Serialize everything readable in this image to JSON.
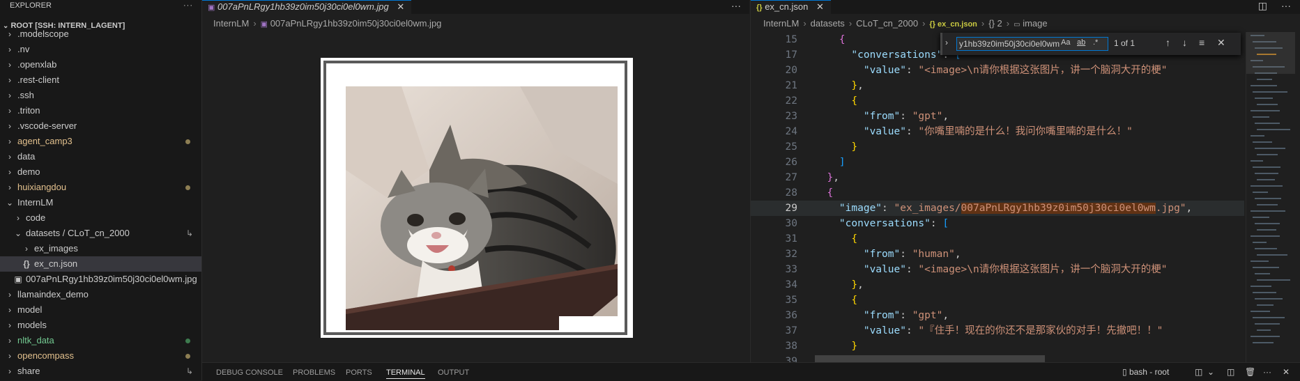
{
  "sidebar": {
    "header": "EXPLORER",
    "root": "ROOT [SSH: INTERN_LAGENT]",
    "items": [
      {
        "label": ".modelscope",
        "kind": "folder",
        "depth": 0,
        "expanded": false,
        "color": "def"
      },
      {
        "label": ".nv",
        "kind": "folder",
        "depth": 0,
        "expanded": false,
        "color": "def"
      },
      {
        "label": ".openxlab",
        "kind": "folder",
        "depth": 0,
        "expanded": false,
        "color": "def"
      },
      {
        "label": ".rest-client",
        "kind": "folder",
        "depth": 0,
        "expanded": false,
        "color": "def"
      },
      {
        "label": ".ssh",
        "kind": "folder",
        "depth": 0,
        "expanded": false,
        "color": "def"
      },
      {
        "label": ".triton",
        "kind": "folder",
        "depth": 0,
        "expanded": false,
        "color": "def"
      },
      {
        "label": ".vscode-server",
        "kind": "folder",
        "depth": 0,
        "expanded": false,
        "color": "def"
      },
      {
        "label": "agent_camp3",
        "kind": "folder",
        "depth": 0,
        "expanded": false,
        "color": "mod",
        "dot": "#8d7e53"
      },
      {
        "label": "data",
        "kind": "folder",
        "depth": 0,
        "expanded": false,
        "color": "def"
      },
      {
        "label": "demo",
        "kind": "folder",
        "depth": 0,
        "expanded": false,
        "color": "def"
      },
      {
        "label": "huixiangdou",
        "kind": "folder",
        "depth": 0,
        "expanded": false,
        "color": "mod",
        "dot": "#8d7e53"
      },
      {
        "label": "InternLM",
        "kind": "folder",
        "depth": 0,
        "expanded": true,
        "color": "def"
      },
      {
        "label": "code",
        "kind": "folder",
        "depth": 1,
        "expanded": false,
        "color": "def"
      },
      {
        "label": "datasets / CLoT_cn_2000",
        "kind": "folder",
        "depth": 1,
        "expanded": true,
        "color": "def",
        "badge": "↳"
      },
      {
        "label": "ex_images",
        "kind": "folder",
        "depth": 2,
        "expanded": false,
        "color": "def"
      },
      {
        "label": "ex_cn.json",
        "kind": "json",
        "depth": 2,
        "color": "def",
        "selected": true
      },
      {
        "label": "007aPnLRgy1hb39z0im50j30ci0el0wm.jpg",
        "kind": "image",
        "depth": 1,
        "color": "def"
      },
      {
        "label": "llamaindex_demo",
        "kind": "folder",
        "depth": 0,
        "expanded": false,
        "color": "def"
      },
      {
        "label": "model",
        "kind": "folder",
        "depth": 0,
        "expanded": false,
        "color": "def"
      },
      {
        "label": "models",
        "kind": "folder",
        "depth": 0,
        "expanded": false,
        "color": "def"
      },
      {
        "label": "nltk_data",
        "kind": "folder",
        "depth": 0,
        "expanded": false,
        "color": "git",
        "dot": "#3d7a4e"
      },
      {
        "label": "opencompass",
        "kind": "folder",
        "depth": 0,
        "expanded": false,
        "color": "mod",
        "dot": "#8d7e53"
      },
      {
        "label": "share",
        "kind": "folder",
        "depth": 0,
        "expanded": false,
        "color": "def",
        "badge": "↳"
      }
    ]
  },
  "left_editor": {
    "tab_label": "007aPnLRgy1hb39z0im50j30ci0el0wm.jpg",
    "breadcrumb": [
      "InternLM",
      "007aPnLRgy1hb39z0im50j30ci0el0wm.jpg"
    ],
    "more": "···"
  },
  "right_editor": {
    "tab_label": "ex_cn.json",
    "breadcrumb": [
      "InternLM",
      "datasets",
      "CLoT_cn_2000",
      "{} ex_cn.json",
      "{} 2",
      "image"
    ],
    "find": {
      "value": "y1hb39z0im50j30ci0el0wm",
      "match_case": "Aa",
      "whole_word": "ab",
      "regex": ".*",
      "result": "1 of 1"
    }
  },
  "code_lines": [
    {
      "n": "15",
      "segs": [
        [
          "b2",
          "    {"
        ]
      ]
    },
    {
      "n": "17",
      "segs": [
        [
          "p",
          "      "
        ],
        [
          "k",
          "\"conversations\""
        ],
        [
          "p",
          ": "
        ],
        [
          "b3",
          "["
        ]
      ]
    },
    {
      "n": "20",
      "segs": [
        [
          "p",
          "        "
        ],
        [
          "k",
          "\"value\""
        ],
        [
          "p",
          ": "
        ],
        [
          "s",
          "\"<image>\\n请你根据这张图片，讲一个脑洞大开的梗\""
        ]
      ]
    },
    {
      "n": "21",
      "segs": [
        [
          "p",
          "      "
        ],
        [
          "b1",
          "}"
        ],
        [
          "p",
          ","
        ]
      ]
    },
    {
      "n": "22",
      "segs": [
        [
          "p",
          "      "
        ],
        [
          "b1",
          "{"
        ]
      ]
    },
    {
      "n": "23",
      "segs": [
        [
          "p",
          "        "
        ],
        [
          "k",
          "\"from\""
        ],
        [
          "p",
          ": "
        ],
        [
          "s",
          "\"gpt\""
        ],
        [
          "p",
          ","
        ]
      ]
    },
    {
      "n": "24",
      "segs": [
        [
          "p",
          "        "
        ],
        [
          "k",
          "\"value\""
        ],
        [
          "p",
          ": "
        ],
        [
          "s",
          "\"你嘴里喃的是什么！我问你嘴里喃的是什么！\""
        ]
      ]
    },
    {
      "n": "25",
      "segs": [
        [
          "p",
          "      "
        ],
        [
          "b1",
          "}"
        ]
      ]
    },
    {
      "n": "26",
      "segs": [
        [
          "p",
          "    "
        ],
        [
          "b3",
          "]"
        ]
      ]
    },
    {
      "n": "27",
      "segs": [
        [
          "b2",
          "  }"
        ],
        [
          "p",
          ","
        ]
      ]
    },
    {
      "n": "28",
      "segs": [
        [
          "b2",
          "  {"
        ]
      ]
    },
    {
      "n": "29",
      "segs": [
        [
          "p",
          "    "
        ],
        [
          "k",
          "\"image\""
        ],
        [
          "p",
          ": "
        ],
        [
          "s",
          "\"ex_images/"
        ],
        [
          "hl",
          "007aPnLRgy1hb39z0im50j30ci0el0wm"
        ],
        [
          "s",
          ".jpg\""
        ],
        [
          "p",
          ","
        ]
      ]
    },
    {
      "n": "30",
      "segs": [
        [
          "p",
          "    "
        ],
        [
          "k",
          "\"conversations\""
        ],
        [
          "p",
          ": "
        ],
        [
          "b3",
          "["
        ]
      ]
    },
    {
      "n": "31",
      "segs": [
        [
          "p",
          "      "
        ],
        [
          "b1",
          "{"
        ]
      ]
    },
    {
      "n": "32",
      "segs": [
        [
          "p",
          "        "
        ],
        [
          "k",
          "\"from\""
        ],
        [
          "p",
          ": "
        ],
        [
          "s",
          "\"human\""
        ],
        [
          "p",
          ","
        ]
      ]
    },
    {
      "n": "33",
      "segs": [
        [
          "p",
          "        "
        ],
        [
          "k",
          "\"value\""
        ],
        [
          "p",
          ": "
        ],
        [
          "s",
          "\"<image>\\n请你根据这张图片，讲一个脑洞大开的梗\""
        ]
      ]
    },
    {
      "n": "34",
      "segs": [
        [
          "p",
          "      "
        ],
        [
          "b1",
          "}"
        ],
        [
          "p",
          ","
        ]
      ]
    },
    {
      "n": "35",
      "segs": [
        [
          "p",
          "      "
        ],
        [
          "b1",
          "{"
        ]
      ]
    },
    {
      "n": "36",
      "segs": [
        [
          "p",
          "        "
        ],
        [
          "k",
          "\"from\""
        ],
        [
          "p",
          ": "
        ],
        [
          "s",
          "\"gpt\""
        ],
        [
          "p",
          ","
        ]
      ]
    },
    {
      "n": "37",
      "segs": [
        [
          "p",
          "        "
        ],
        [
          "k",
          "\"value\""
        ],
        [
          "p",
          ": "
        ],
        [
          "s",
          "\"『住手！现在的你还不是那家伙的对手！先撤吧！！\""
        ]
      ]
    },
    {
      "n": "38",
      "segs": [
        [
          "p",
          "      "
        ],
        [
          "b1",
          "}"
        ]
      ]
    },
    {
      "n": "39",
      "segs": [
        [
          "p",
          "    "
        ],
        [
          "b3",
          "]"
        ]
      ]
    }
  ],
  "panel": {
    "tabs": [
      "DEBUG CONSOLE",
      "PROBLEMS",
      "PORTS",
      "TERMINAL",
      "OUTPUT"
    ],
    "active": "TERMINAL",
    "terminal_name": "bash - root"
  },
  "colors": {
    "accent": "#0078d4",
    "find_highlight": "#613214"
  },
  "icons": {
    "folder_closed": "chevron-right-icon",
    "folder_open": "chevron-down-icon",
    "json": "json-file-icon",
    "image": "image-file-icon"
  }
}
